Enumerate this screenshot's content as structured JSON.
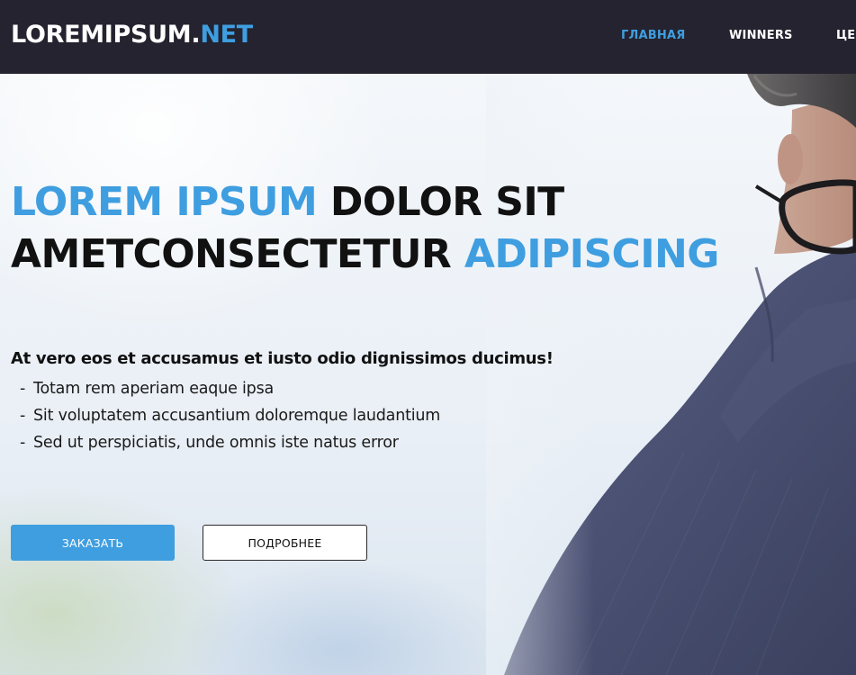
{
  "header": {
    "logo_main": "LOREMIPSUM.",
    "logo_accent": "NET",
    "nav": [
      {
        "label": "ГЛАВНАЯ",
        "active": true
      },
      {
        "label": "WINNERS",
        "active": false
      },
      {
        "label": "ЦЕН",
        "active": false
      }
    ]
  },
  "hero": {
    "headline": {
      "line1_accent": "LOREM IPSUM",
      "line1_rest": " DOLOR SIT",
      "line2_rest": "AMETCONSECTETUR ",
      "line2_accent": "ADIPISCING"
    },
    "lead": "At vero eos et accusamus et iusto odio dignissimos ducimus!",
    "bullets": [
      "Totam rem aperiam eaque ipsa",
      "Sit voluptatem accusantium doloremque laudantium",
      "Sed ut perspiciatis, unde omnis iste natus error"
    ],
    "bullet_marker": "-",
    "buttons": {
      "primary": "ЗАКАЗАТЬ",
      "secondary": "ПОДРОБНЕЕ"
    }
  },
  "colors": {
    "accent": "#3f9ee0",
    "header_bg": "#24232f",
    "text": "#111111"
  }
}
